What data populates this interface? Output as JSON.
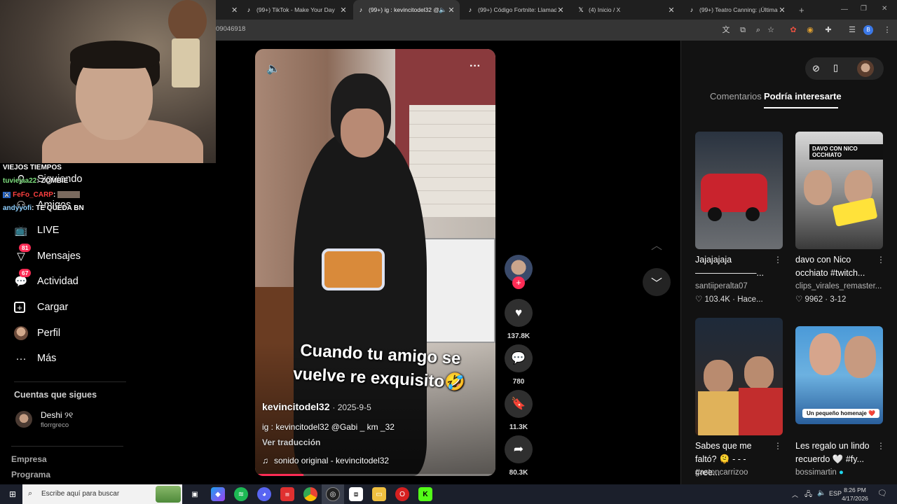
{
  "browser": {
    "tabs": [
      {
        "title": "(99+) TikTok - Make Your Day",
        "icon": "tiktok-icon",
        "active": false
      },
      {
        "title": "(99+) ig : kevincitodel32 @",
        "icon": "tiktok-icon",
        "active": true
      },
      {
        "title": "(99+) Código Fortnite: Llamada",
        "icon": "tiktok-icon",
        "active": false
      },
      {
        "title": "(4) Inicio / X",
        "icon": "x-icon",
        "active": false
      },
      {
        "title": "(99+) Teatro Canning: ¡Últimas",
        "icon": "tiktok-icon",
        "active": false
      }
    ],
    "url_fragment": "09046918",
    "profile_initial": "B"
  },
  "stream_overlay": {
    "chat": [
      {
        "user": "VIEJOS TIEMPOS",
        "text": "",
        "color": "#ffffff"
      },
      {
        "user": "tuviejaa22",
        "text": ": ZOMBIE",
        "color": "#7fe07f"
      },
      {
        "user": "FeFo_CARP",
        "text": ":",
        "color": "#ff4040"
      },
      {
        "user": "andyyofi",
        "text": ": TE QUEDA BN",
        "color": "#8fd0ff"
      }
    ]
  },
  "sidebar": {
    "items": [
      {
        "label": "Siguiendo",
        "icon": "following-icon"
      },
      {
        "label": "Amigos",
        "icon": "friends-icon"
      },
      {
        "label": "LIVE",
        "icon": "live-icon"
      },
      {
        "label": "Mensajes",
        "icon": "messages-icon",
        "badge": "81"
      },
      {
        "label": "Actividad",
        "icon": "activity-icon",
        "badge": "67"
      },
      {
        "label": "Cargar",
        "icon": "upload-icon"
      },
      {
        "label": "Perfil",
        "icon": "profile-avatar"
      },
      {
        "label": "Más",
        "icon": "more-icon"
      }
    ],
    "following_heading": "Cuentas que sigues",
    "following": [
      {
        "name": "Deshi ୨୧",
        "handle": "florrgreco"
      }
    ],
    "footer": [
      "Empresa",
      "Programa"
    ]
  },
  "video": {
    "caption_overlay": "Cuando tu amigo se vuelve re exquisito🤣",
    "author": "kevincitodel32",
    "date": "· 2025-9-5",
    "description": "ig : kevincitodel32 @Gabi _ km _32",
    "translate": "Ver traducción",
    "sound": "sonido original - kevincitodel32",
    "progress": 0.2
  },
  "actions": {
    "likes": "137.8K",
    "comments": "780",
    "saves": "11.3K",
    "shares": "80.3K"
  },
  "right_panel": {
    "tabs": [
      "Comentarios",
      "Podría interesarte"
    ],
    "active_tab": "Podría interesarte",
    "recommendations": [
      {
        "title": "Jajajajaja ———————...",
        "author": "santiiperalta07",
        "likes": "103.4K",
        "when": "Hace..."
      },
      {
        "title": "davo con Nico occhiato #twitch...",
        "author": "clips_virales_remaster...",
        "likes": "9962",
        "when": "3-12",
        "thumb_text": "DAVO CON NICO OCCHIATO"
      },
      {
        "title": "Sabes que me faltó? 🫠 - - - #ree...",
        "author": "gastoncarrizoo"
      },
      {
        "title": "Les regalo un lindo recuerdo 🤍 #fy...",
        "author": "bossimartin",
        "thumb_text": "Un pequeño homenaje ❤️"
      }
    ]
  },
  "taskbar": {
    "search_placeholder": "Escribe aquí para buscar",
    "lang": "ESP",
    "time": "8:26 PM",
    "date": "4/17/2026"
  },
  "colors": {
    "accent": "#fe2c55",
    "background": "#121212"
  }
}
